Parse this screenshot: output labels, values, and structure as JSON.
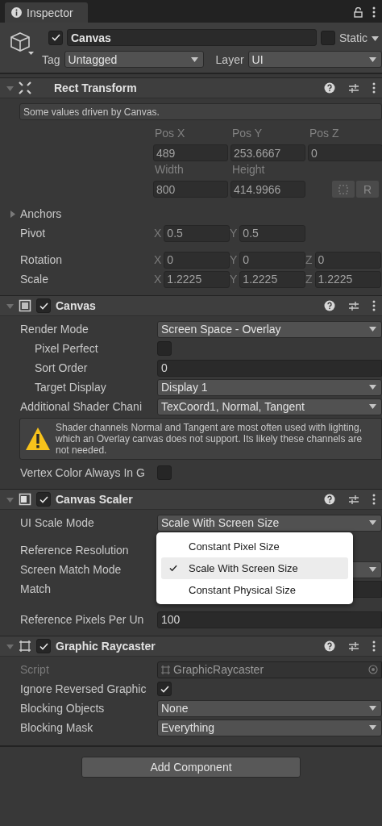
{
  "tab": {
    "title": "Inspector"
  },
  "object": {
    "active": true,
    "name": "Canvas",
    "static": false,
    "static_label": "Static",
    "tag_label": "Tag",
    "tag": "Untagged",
    "layer_label": "Layer",
    "layer": "UI"
  },
  "rect_transform": {
    "kind": "transform",
    "title": "Rect Transform",
    "expanded": true,
    "note": "Some values driven by Canvas.",
    "grid": [
      {
        "label": "Pos X",
        "value": "489"
      },
      {
        "label": "Pos Y",
        "value": "253.6667"
      },
      {
        "label": "Pos Z",
        "value": "0"
      },
      {
        "label": "Width",
        "value": "800"
      },
      {
        "label": "Height",
        "value": "414.9966"
      }
    ],
    "button_label": "R",
    "anchors": {
      "label": "Anchors",
      "expanded": false
    },
    "vectors": [
      {
        "label": "Pivot",
        "axes": [
          {
            "axis": "X",
            "value": "0.5"
          },
          {
            "axis": "Y",
            "value": "0.5"
          }
        ]
      },
      {
        "label": "Rotation",
        "axes": [
          {
            "axis": "X",
            "value": "0"
          },
          {
            "axis": "Y",
            "value": "0"
          },
          {
            "axis": "Z",
            "value": "0"
          }
        ]
      },
      {
        "label": "Scale",
        "axes": [
          {
            "axis": "X",
            "value": "1.2225"
          },
          {
            "axis": "Y",
            "value": "1.2225"
          },
          {
            "axis": "Z",
            "value": "1.2225"
          }
        ]
      }
    ]
  },
  "components": [
    {
      "kind": "canvas",
      "title": "Canvas",
      "enabled": true,
      "expanded": true,
      "rows": [
        {
          "kind": "dropdown",
          "label": "Render Mode",
          "value": "Screen Space - Overlay",
          "children": [
            {
              "kind": "checkbox",
              "label": "Pixel Perfect",
              "checked": false
            },
            {
              "kind": "field",
              "label": "Sort Order",
              "value": "0"
            },
            {
              "kind": "dropdown",
              "label": "Target Display",
              "value": "Display 1"
            }
          ]
        },
        {
          "kind": "dropdown",
          "label": "Additional Shader Chani",
          "value": "TexCoord1, Normal, Tangent"
        },
        {
          "kind": "warning",
          "text": "Shader channels Normal and Tangent are most often used with lighting, which an Overlay canvas does not support. Its likely these channels are not needed."
        },
        {
          "kind": "checkbox",
          "label": "Vertex Color Always In G",
          "checked": false
        }
      ]
    },
    {
      "kind": "scaler",
      "title": "Canvas Scaler",
      "enabled": true,
      "expanded": true,
      "rows": [
        {
          "kind": "dropdown",
          "label": "UI Scale Mode",
          "value": "Scale With Screen Size",
          "menu": [
            {
              "label": "Constant Pixel Size",
              "selected": false
            },
            {
              "label": "Scale With Screen Size",
              "selected": true
            },
            {
              "label": "Constant Physical Size",
              "selected": false
            }
          ]
        },
        {
          "kind": "resolution",
          "label": "Reference Resolution"
        },
        {
          "kind": "dropdown",
          "label": "Screen Match Mode"
        },
        {
          "kind": "slider",
          "label": "Match"
        },
        {
          "kind": "field",
          "label": "Reference Pixels Per Un",
          "value": "100"
        }
      ]
    },
    {
      "kind": "raycaster",
      "title": "Graphic Raycaster",
      "enabled": true,
      "expanded": true,
      "rows": [
        {
          "kind": "object",
          "label": "Script",
          "value": "GraphicRaycaster",
          "disabled": true
        },
        {
          "kind": "checkbox",
          "label": "Ignore Reversed Graphic",
          "checked": true
        },
        {
          "kind": "dropdown",
          "label": "Blocking Objects",
          "value": "None"
        },
        {
          "kind": "dropdown",
          "label": "Blocking Mask",
          "value": "Everything"
        }
      ]
    }
  ],
  "add_button": "Add Component"
}
